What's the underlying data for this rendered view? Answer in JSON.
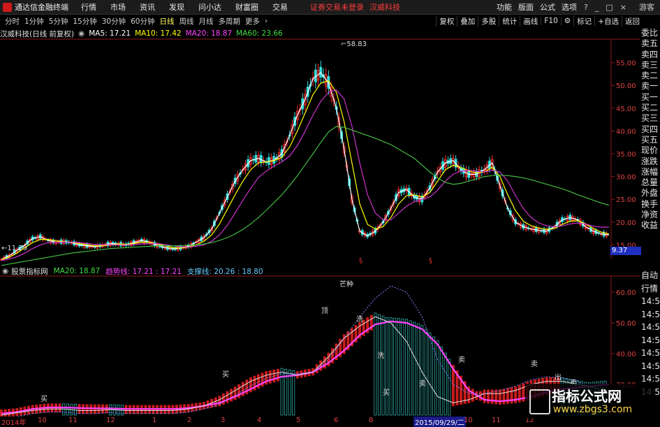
{
  "titlebar": {
    "app_title": "通达信金融终端",
    "menus": [
      "行情",
      "市场",
      "资讯",
      "发现",
      "问小达",
      "财富圈",
      "交易"
    ],
    "login_warning": "证券交易未登录",
    "stock_name": "汉威科技",
    "right_menus": [
      "功能",
      "版面",
      "公式",
      "选项"
    ],
    "guest": "游客"
  },
  "periods": {
    "items": [
      "分时",
      "1分钟",
      "5分钟",
      "15分钟",
      "30分钟",
      "60分钟",
      "日线",
      "周线",
      "月线",
      "多周期",
      "更多"
    ],
    "active": "日线"
  },
  "toolbar": [
    "复权",
    "叠加",
    "多股",
    "统计",
    "画线",
    "F10",
    "标记",
    "+自选",
    "返回"
  ],
  "main_chart": {
    "title": "汉威科技(日线 前复权)",
    "ma5": "MA5: 17.21",
    "ma10": "MA10: 17.42",
    "ma20": "MA20: 18.87",
    "ma60": "MA60: 23.66",
    "high_label": "58.83",
    "low_label": "11.39",
    "last_price": "9.37",
    "y_ticks": [
      "55.00",
      "50.00",
      "45.00",
      "40.00",
      "35.00",
      "30.00",
      "25.00",
      "20.00",
      "15.00"
    ]
  },
  "indicator": {
    "title": "股票指标网",
    "ma20": "MA20: 18.87",
    "trend": "趋势线: 17.21 : 17.21",
    "support": "支撑线: 20.26 : 18.80",
    "y_ticks": [
      "60.00",
      "50.00",
      "40.00",
      "30.00"
    ],
    "labels": [
      "芒种",
      "顶",
      "洗",
      "洗",
      "买",
      "卖",
      "卖",
      "买",
      "买",
      "卖",
      "出",
      "卖"
    ]
  },
  "quote_panel": [
    "委比",
    "卖五",
    "卖四",
    "卖三",
    "卖二",
    "卖一",
    "买一",
    "买二",
    "买三",
    "买四",
    "买五",
    "现价",
    "涨跌",
    "涨幅",
    "总量",
    "外盘",
    "换手",
    "净资",
    "收益"
  ],
  "quote_panel_2": [
    "自动",
    "行情",
    "14:56",
    "14:56",
    "14:56",
    "14:56",
    "14:56",
    "14:56",
    "14:56",
    "14:56"
  ],
  "date_axis": {
    "ticks": [
      "2014年",
      "10",
      "11",
      "12",
      "1",
      "2",
      "3",
      "4",
      "5",
      "6",
      "8",
      "10",
      "11",
      "12"
    ],
    "highlight": "2015/09/29/二"
  },
  "watermark": {
    "title": "指标公式网",
    "url": "www.zbgs3.com"
  },
  "chart_data": [
    {
      "type": "line",
      "title": "汉威科技(日线 前复权)",
      "ylim": [
        12,
        60
      ],
      "x": [
        0,
        4,
        8,
        12,
        16,
        20,
        24,
        28,
        32,
        36,
        40,
        44,
        48,
        52,
        56,
        60,
        64,
        68,
        72,
        76,
        80,
        84,
        88,
        92,
        96,
        100,
        104,
        108,
        112,
        116,
        120,
        124,
        128,
        132,
        136,
        140,
        144,
        148,
        152,
        156,
        160,
        164,
        168,
        172,
        176,
        180,
        184,
        188,
        192,
        196,
        200,
        204,
        208,
        212,
        216,
        220,
        224,
        228,
        232,
        236,
        240,
        244,
        248,
        252,
        256,
        260,
        264,
        268,
        272,
        276,
        280,
        284,
        288,
        292,
        296,
        300,
        304,
        308,
        312
      ],
      "series": [
        {
          "name": "MA5",
          "color": "#ffffff",
          "values": [
            11.8,
            12.6,
            13.8,
            15.0,
            16.4,
            16.8,
            16.0,
            15.6,
            15.7,
            15.5,
            15.0,
            14.8,
            14.6,
            14.9,
            15.3,
            15.2,
            15.0,
            15.5,
            16.0,
            15.6,
            14.9,
            14.4,
            14.1,
            14.3,
            14.7,
            15.6,
            16.6,
            18.5,
            22.0,
            25.5,
            29.0,
            31.5,
            33.5,
            34.0,
            33.2,
            33.6,
            35.0,
            39.0,
            43.5,
            47.0,
            51.5,
            52.8,
            50.5,
            45.0,
            36.0,
            25.0,
            18.0,
            17.0,
            18.0,
            20.0,
            23.0,
            26.5,
            27.2,
            25.5,
            25.0,
            27.5,
            31.0,
            33.0,
            33.5,
            31.5,
            30.5,
            30.5,
            31.5,
            33.0,
            28.0,
            23.0,
            20.0,
            19.0,
            18.5,
            18.2,
            18.0,
            19.0,
            20.5,
            21.0,
            20.5,
            19.0,
            18.0,
            17.4,
            17.2
          ]
        },
        {
          "name": "MA10",
          "color": "#ffff00",
          "values": [
            11.8,
            12.3,
            13.2,
            14.4,
            15.5,
            16.2,
            16.2,
            15.9,
            15.7,
            15.6,
            15.3,
            15.0,
            14.8,
            14.8,
            15.0,
            15.2,
            15.1,
            15.3,
            15.6,
            15.6,
            15.2,
            14.8,
            14.4,
            14.3,
            14.5,
            15.0,
            15.8,
            17.2,
            19.6,
            22.8,
            26.0,
            29.0,
            31.5,
            33.0,
            33.2,
            33.5,
            34.2,
            36.5,
            40.0,
            44.0,
            48.0,
            50.5,
            51.0,
            48.5,
            42.0,
            33.0,
            24.0,
            19.5,
            18.5,
            19.0,
            21.0,
            24.0,
            25.8,
            26.0,
            25.5,
            26.5,
            29.0,
            31.5,
            32.5,
            32.0,
            31.2,
            30.8,
            31.0,
            32.0,
            30.0,
            26.0,
            22.5,
            20.2,
            19.2,
            18.7,
            18.4,
            18.6,
            19.5,
            20.2,
            20.3,
            19.6,
            18.6,
            17.8,
            17.4
          ]
        },
        {
          "name": "MA20",
          "color": "#cc33cc",
          "values": [
            11.6,
            11.9,
            12.4,
            13.2,
            14.2,
            15.0,
            15.5,
            15.6,
            15.6,
            15.6,
            15.5,
            15.3,
            15.1,
            15.0,
            15.0,
            15.0,
            15.0,
            15.1,
            15.2,
            15.3,
            15.3,
            15.1,
            14.8,
            14.6,
            14.5,
            14.7,
            15.0,
            15.8,
            17.2,
            19.3,
            22.0,
            24.8,
            27.4,
            29.8,
            31.2,
            32.3,
            33.2,
            34.5,
            36.8,
            40.0,
            43.5,
            46.5,
            48.5,
            49.0,
            47.0,
            41.0,
            33.0,
            26.0,
            22.0,
            20.5,
            20.5,
            22.0,
            23.5,
            24.5,
            25.0,
            25.5,
            27.0,
            29.0,
            30.5,
            31.2,
            31.4,
            31.2,
            31.0,
            31.4,
            31.0,
            29.0,
            25.8,
            23.0,
            21.0,
            19.8,
            19.2,
            19.0,
            19.2,
            19.6,
            19.8,
            19.6,
            19.1,
            18.9,
            18.9
          ]
        },
        {
          "name": "MA60",
          "color": "#44bb44",
          "values": [
            10.5,
            10.8,
            11.1,
            11.4,
            11.7,
            12.0,
            12.3,
            12.6,
            12.9,
            13.2,
            13.4,
            13.6,
            13.8,
            14.0,
            14.2,
            14.3,
            14.4,
            14.5,
            14.6,
            14.7,
            14.8,
            14.8,
            14.8,
            14.8,
            14.9,
            15.0,
            15.2,
            15.5,
            16.0,
            16.6,
            17.4,
            18.4,
            19.6,
            21.0,
            22.6,
            24.3,
            26.0,
            28.0,
            30.2,
            32.6,
            35.0,
            37.5,
            39.8,
            41.0,
            40.8,
            40.2,
            39.6,
            39.0,
            38.4,
            37.7,
            37.0,
            36.0,
            35.0,
            34.0,
            32.5,
            31.0,
            29.7,
            28.7,
            28.3,
            28.5,
            29.0,
            29.5,
            30.0,
            30.2,
            30.3,
            30.2,
            30.0,
            29.7,
            29.3,
            28.8,
            28.3,
            27.8,
            27.3,
            26.7,
            26.0,
            25.4,
            24.8,
            24.2,
            23.7
          ]
        }
      ]
    },
    {
      "type": "line",
      "title": "股票指标网",
      "ylim": [
        20,
        65
      ],
      "x": [
        0,
        8,
        16,
        24,
        32,
        40,
        48,
        56,
        64,
        72,
        80,
        88,
        96,
        104,
        112,
        120,
        128,
        136,
        144,
        152,
        160,
        168,
        176,
        184,
        192,
        200,
        208,
        216,
        224,
        232,
        240,
        248,
        256,
        264,
        272,
        280,
        288,
        296,
        304,
        312
      ],
      "series": [
        {
          "name": "MA20",
          "color": "#ff44ff",
          "values": [
            20.5,
            21.0,
            22.0,
            22.5,
            22.5,
            22.3,
            22.2,
            22.2,
            22.0,
            22.0,
            22.0,
            22.0,
            22.3,
            23.0,
            24.0,
            26.0,
            28.5,
            31.0,
            32.5,
            33.0,
            34.0,
            37.0,
            41.0,
            46.0,
            49.5,
            50.5,
            50.0,
            48.0,
            43.0,
            35.0,
            28.0,
            25.0,
            24.5,
            25.0,
            26.0,
            27.5,
            28.5,
            29.0,
            29.5,
            30.0
          ]
        },
        {
          "name": "趋势线",
          "color": "#e0e0e0",
          "values": [
            20.0,
            20.8,
            21.5,
            22.0,
            22.0,
            21.5,
            21.5,
            21.8,
            21.5,
            21.5,
            21.5,
            21.5,
            22.0,
            23.0,
            25.0,
            28.0,
            31.0,
            33.0,
            34.0,
            33.0,
            34.0,
            39.0,
            45.0,
            49.0,
            52.0,
            50.0,
            44.0,
            34.0,
            26.0,
            24.0,
            25.0,
            27.0,
            27.0,
            28.0,
            30.0,
            31.0,
            31.0,
            30.0,
            29.0,
            27.0
          ]
        },
        {
          "name": "支撑线",
          "color": "#8888ff",
          "values": [
            19.0,
            19.5,
            20.5,
            21.0,
            21.0,
            20.5,
            20.5,
            20.8,
            20.5,
            20.5,
            20.5,
            20.5,
            21.0,
            22.0,
            23.5,
            26.5,
            29.5,
            32.0,
            33.5,
            33.5,
            34.0,
            38.0,
            45.0,
            52.0,
            58.0,
            62.0,
            60.0,
            52.0,
            38.0,
            30.0,
            27.0,
            27.0,
            28.0,
            29.5,
            31.5,
            32.5,
            32.0,
            31.0,
            28.0,
            24.0
          ]
        }
      ]
    }
  ]
}
